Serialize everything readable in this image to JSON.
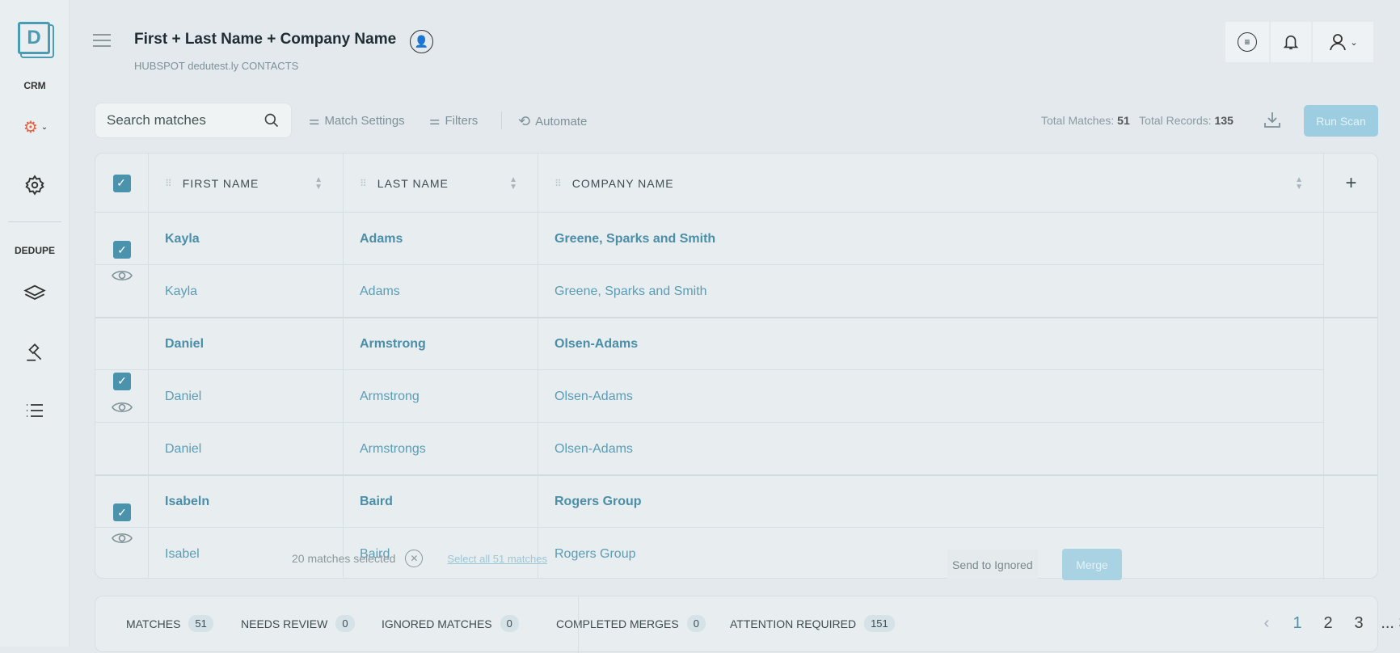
{
  "sidebar": {
    "logo": "D",
    "crm_label": "CRM",
    "dedupe_label": "DEDUPE",
    "crm_icon": "hubspot-icon",
    "items": [
      "settings-icon",
      "layers-icon",
      "gavel-icon",
      "list-icon"
    ]
  },
  "header": {
    "title": "First + Last Name + Company Name",
    "subtitle": "HUBSPOT dedutest.ly CONTACTS"
  },
  "toolbar": {
    "search_placeholder": "Search matches",
    "match_settings": "Match Settings",
    "filters": "Filters",
    "automate": "Automate",
    "total_matches_label": "Total Matches:",
    "total_matches": "51",
    "total_records_label": "Total Records:",
    "total_records": "135",
    "run_scan": "Run Scan"
  },
  "table": {
    "columns": [
      "FIRST NAME",
      "LAST NAME",
      "COMPANY NAME"
    ],
    "groups": [
      {
        "checked": true,
        "rows": [
          [
            "Kayla",
            "Adams",
            "Greene, Sparks and Smith"
          ],
          [
            "Kayla",
            "Adams",
            "Greene, Sparks and Smith"
          ]
        ]
      },
      {
        "checked": true,
        "rows": [
          [
            "Daniel",
            "Armstrong",
            "Olsen-Adams"
          ],
          [
            "Daniel",
            "Armstrong",
            "Olsen-Adams"
          ],
          [
            "Daniel",
            "Armstrongs",
            "Olsen-Adams"
          ]
        ]
      },
      {
        "checked": true,
        "rows": [
          [
            "Isabeln",
            "Baird",
            "Rogers Group"
          ],
          [
            "Isabel",
            "Baird",
            "Rogers Group"
          ]
        ]
      }
    ]
  },
  "selection": {
    "count_text": "20 matches selected",
    "select_all": "Select all 51 matches",
    "send_to_ignored": "Send to Ignored",
    "merge": "Merge"
  },
  "footer": {
    "tabs": [
      {
        "label": "MATCHES",
        "count": "51"
      },
      {
        "label": "NEEDS REVIEW",
        "count": "0"
      },
      {
        "label": "IGNORED MATCHES",
        "count": "0"
      },
      {
        "label": "COMPLETED MERGES",
        "count": "0"
      },
      {
        "label": "ATTENTION REQUIRED",
        "count": "151"
      }
    ],
    "pages": [
      "1",
      "2",
      "3",
      "... 3"
    ],
    "current_page": "1"
  },
  "colors": {
    "accent": "#4b93ad",
    "run_scan": "#9ccde0"
  }
}
